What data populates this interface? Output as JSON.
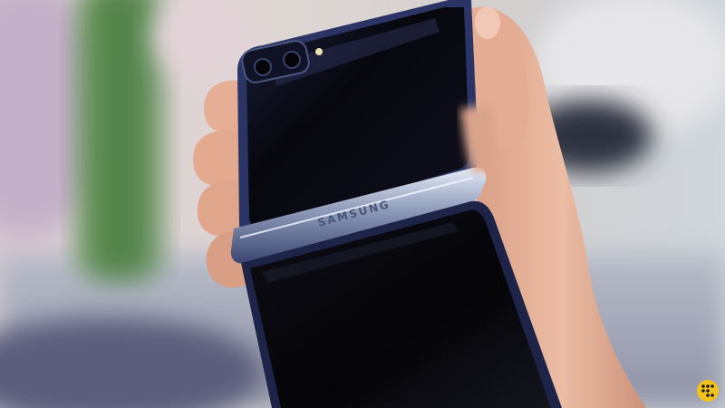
{
  "photo": {
    "subject": "phone-in-hand",
    "brand_wordmark": "SAMSUNG",
    "watermark_icon": "dot-grid-logo-icon",
    "colors": {
      "background_warm": "#d9cfcb",
      "background_cool": "#c9d0d8",
      "plant_green": "#5f8f52",
      "phone_body": "#07070c",
      "phone_frame": "#2a3566",
      "hinge_metal": "#9aa6c4",
      "skin": "#e8b49c",
      "watermark": "#f2c21b"
    }
  }
}
